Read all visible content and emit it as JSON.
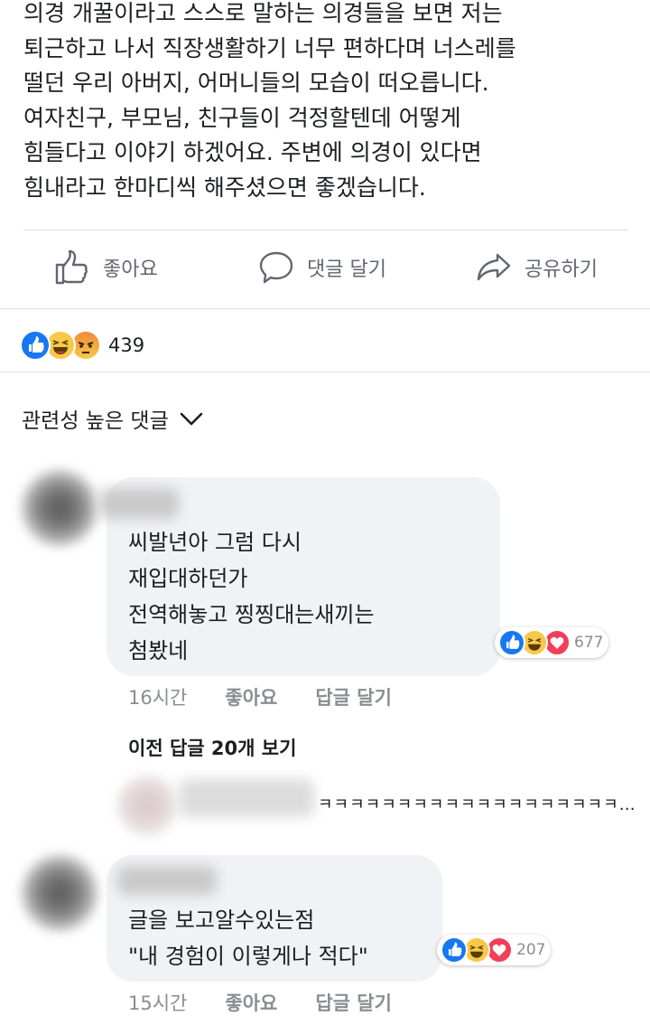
{
  "post": {
    "lines": [
      "의경 개꿀이라고 스스로 말하는 의경들을 보면 저는",
      "퇴근하고 나서 직장생활하기 너무 편하다며 너스레를",
      "떨던 우리 아버지, 어머니들의 모습이 떠오릅니다.",
      "여자친구, 부모님, 친구들이 걱정할텐데 어떻게",
      "힘들다고 이야기 하겠어요. 주변에 의경이 있다면",
      "힘내라고 한마디씩 해주셨으면 좋겠습니다."
    ]
  },
  "actions": {
    "like": "좋아요",
    "comment": "댓글 달기",
    "share": "공유하기"
  },
  "reactions": {
    "icons": [
      "like-icon",
      "haha-icon",
      "angry-icon"
    ],
    "count": "439"
  },
  "sort": {
    "label": "관련성 높은 댓글"
  },
  "comments": [
    {
      "lines": [
        "씨발년아 그럼 다시",
        "재입대하던가",
        "전역해놓고 찡찡대는새끼는",
        "첨봤네"
      ],
      "reaction_count": "677",
      "time": "16시간",
      "like": "좋아요",
      "reply": "답글 달기"
    },
    {
      "lines": [
        "글을 보고알수있는점",
        "\"내 경험이 이렇게나 적다\""
      ],
      "reaction_count": "207",
      "time": "15시간",
      "like": "좋아요",
      "reply": "답글 달기"
    }
  ],
  "replies": {
    "prev_label": "이전 답글 20개 보기",
    "preview_text": "ㅋㅋㅋㅋㅋㅋㅋㅋㅋㅋㅋㅋㅋㅋㅋㅋㅋㅋㅋ…"
  },
  "colors": {
    "like_blue": "#1877f2",
    "haha_yellow": "#f7c948",
    "love_red": "#f33e58",
    "bubble_bg": "#f0f2f5",
    "meta_gray": "#8a8d91"
  }
}
